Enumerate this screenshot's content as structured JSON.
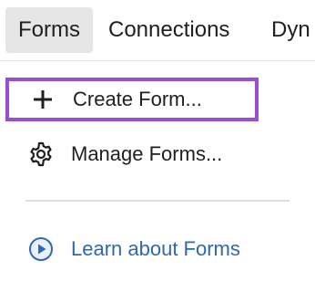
{
  "menubar": {
    "tabs": [
      {
        "label": "Forms"
      },
      {
        "label": "Connections"
      },
      {
        "label": "Dyn"
      }
    ]
  },
  "dropdown": {
    "items": [
      {
        "label": "Create Form...",
        "icon": "plus-icon"
      },
      {
        "label": "Manage Forms...",
        "icon": "gear-icon"
      },
      {
        "label": "Learn about Forms",
        "icon": "play-circle-icon"
      }
    ]
  },
  "colors": {
    "highlight_border": "#9b4dd4",
    "link": "#2f68b3",
    "active_tab_bg": "#e6e6e6"
  }
}
